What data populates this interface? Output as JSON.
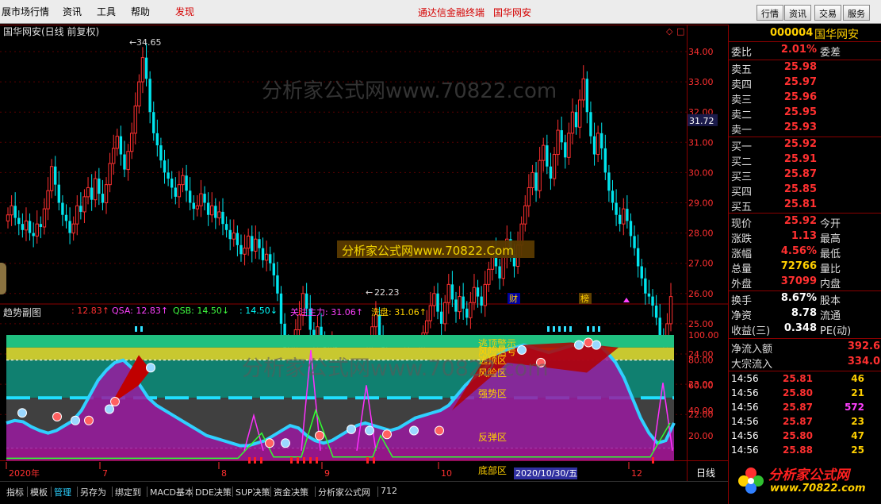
{
  "menu": {
    "market": "展市场行情",
    "news": "资讯",
    "tools": "工具",
    "help": "帮助",
    "discover": "发现",
    "center_title": "通达信金融终端",
    "center_stock": "国华网安",
    "buttons": [
      "行情",
      "资讯",
      "交易",
      "服务"
    ]
  },
  "main_chart": {
    "title": "国华网安(日线 前复权)",
    "price_axis": [
      "34.00",
      "33.00",
      "32.00",
      "31.00",
      "30.00",
      "29.00",
      "28.00",
      "27.00",
      "26.00",
      "25.00",
      "24.00",
      "23.00",
      "22.00"
    ],
    "current_price_tag": "31.72",
    "high_label": "34.65",
    "low_label": "22.23",
    "watermark": "分析家公式网www.70822.com",
    "promo_banner": "分析家公式网www.70822.Com",
    "marker_cai": "财",
    "marker_bang": "榜"
  },
  "sub_chart": {
    "title": "趋势副图",
    "indicators": [
      {
        "text": ": 12.83↑",
        "color": "#ff3030"
      },
      {
        "text": "QSA: 12.83↑",
        "color": "#ff40ff"
      },
      {
        "text": "QSB: 14.50↓",
        "color": "#40ff40"
      },
      {
        "text": ": 14.50↓",
        "color": "#00ffff"
      },
      {
        "text": "关注主力: 31.06↑",
        "color": "#ff40ff"
      },
      {
        "text": "洗盘: 31.06↑",
        "color": "#ffd000"
      }
    ],
    "axis": [
      "100.00",
      "80.00",
      "60.00",
      "40.00",
      "20.00"
    ],
    "zones": [
      "逃顶警示",
      "风险信号",
      "逃顶区",
      "风险区",
      "强势区",
      "反弹区",
      "底部区"
    ],
    "watermark": "分析家公式网www.70822.com"
  },
  "date_axis": {
    "labels": [
      "2020年",
      "7",
      "8",
      "9",
      "10",
      "12"
    ],
    "highlight": "2020/10/30/五",
    "period": "日线"
  },
  "tabs": [
    "指标",
    "模板",
    "管理",
    "另存为",
    "绑定到",
    "MACD基本",
    "DDE决策",
    "SUP决策",
    "资金决策",
    "分析家公式网",
    "712"
  ],
  "panel": {
    "code": "000004",
    "name": "国华网安",
    "weibi_label": "委比",
    "weibi_value": "2.01%",
    "weicha_label": "委差",
    "sell": [
      {
        "label": "卖五",
        "price": "25.98"
      },
      {
        "label": "卖四",
        "price": "25.97"
      },
      {
        "label": "卖三",
        "price": "25.96"
      },
      {
        "label": "卖二",
        "price": "25.95"
      },
      {
        "label": "卖一",
        "price": "25.93"
      }
    ],
    "buy": [
      {
        "label": "买一",
        "price": "25.92"
      },
      {
        "label": "买二",
        "price": "25.91"
      },
      {
        "label": "买三",
        "price": "25.87"
      },
      {
        "label": "买四",
        "price": "25.85"
      },
      {
        "label": "买五",
        "price": "25.81"
      }
    ],
    "quote": [
      {
        "label": "现价",
        "value": "25.92",
        "label2": "今开"
      },
      {
        "label": "涨跌",
        "value": "1.13",
        "label2": "最高"
      },
      {
        "label": "涨幅",
        "value": "4.56%",
        "label2": "最低"
      },
      {
        "label": "总量",
        "value": "72766",
        "label2": "量比"
      },
      {
        "label": "外盘",
        "value": "37099",
        "label2": "内盘"
      }
    ],
    "stats": [
      {
        "label": "换手",
        "value": "8.67%",
        "label2": "股本"
      },
      {
        "label": "净资",
        "value": "8.78",
        "label2": "流通"
      },
      {
        "label": "收益(三)",
        "value": "0.348",
        "label2": "PE(动)"
      }
    ],
    "flow": [
      {
        "label": "净流入额",
        "value": "392.6"
      },
      {
        "label": "大宗流入",
        "value": "334.0"
      }
    ],
    "ticks": [
      {
        "time": "14:56",
        "price": "25.81",
        "vol": "46"
      },
      {
        "time": "14:56",
        "price": "25.80",
        "vol": "21"
      },
      {
        "time": "14:56",
        "price": "25.87",
        "vol": "572"
      },
      {
        "time": "14:56",
        "price": "25.87",
        "vol": "23"
      },
      {
        "time": "14:56",
        "price": "25.80",
        "vol": "47"
      },
      {
        "time": "14:56",
        "price": "25.88",
        "vol": "25"
      }
    ],
    "logo_text": "分析家公式网",
    "logo_url": "www.70822.com"
  }
}
